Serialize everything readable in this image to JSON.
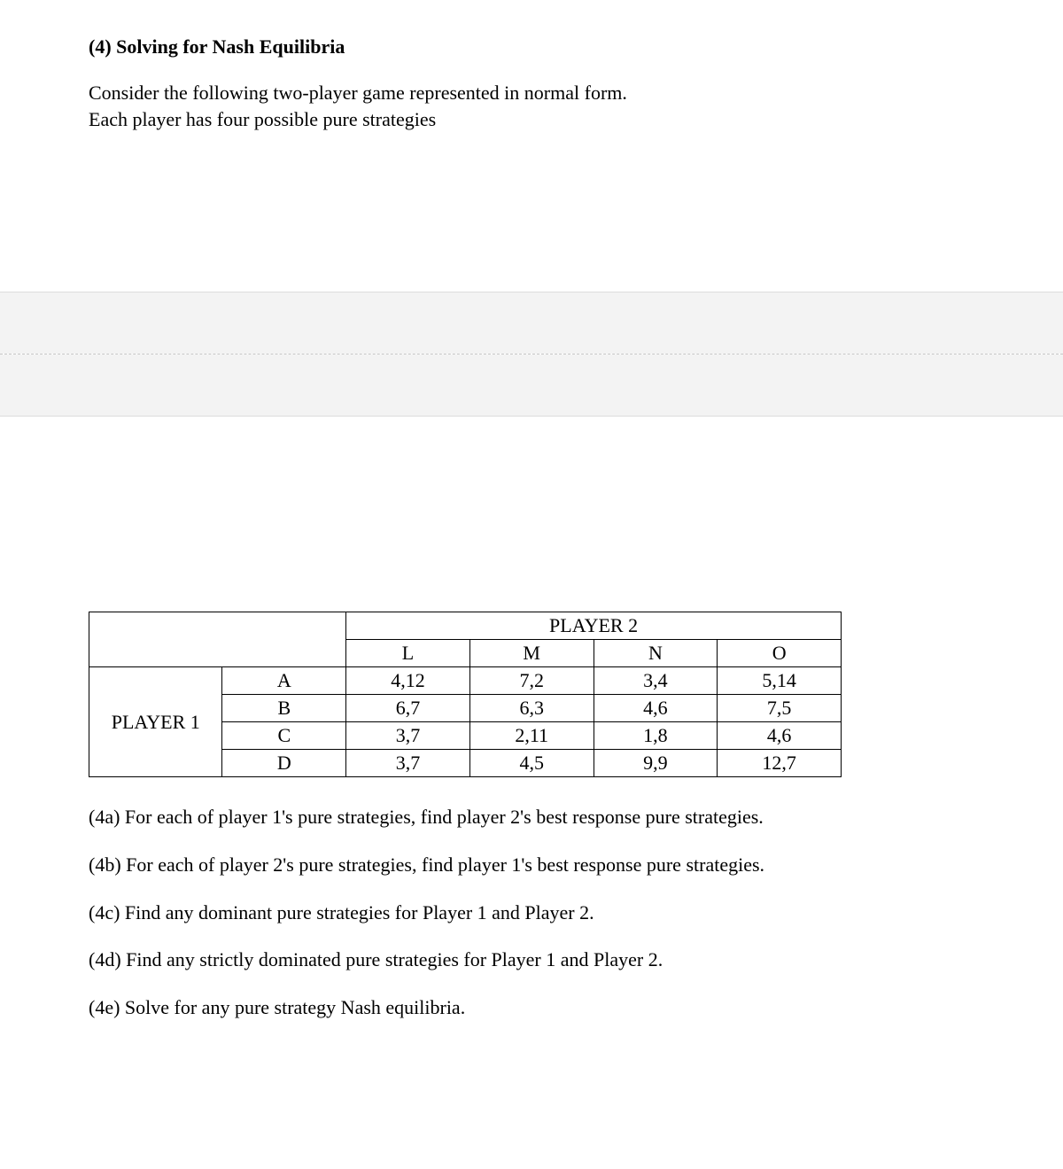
{
  "title": "(4) Solving for Nash Equilibria",
  "intro_line1": "Consider the following two-player game represented in normal form.",
  "intro_line2": "Each player has four possible pure strategies",
  "table": {
    "player2_label": "PLAYER 2",
    "player1_label": "PLAYER 1",
    "col_headers": [
      "L",
      "M",
      "N",
      "O"
    ],
    "row_headers": [
      "A",
      "B",
      "C",
      "D"
    ],
    "cells": [
      [
        "4,12",
        "7,2",
        "3,4",
        "5,14"
      ],
      [
        "6,7",
        "6,3",
        "4,6",
        "7,5"
      ],
      [
        "3,7",
        "2,11",
        "1,8",
        "4,6"
      ],
      [
        "3,7",
        "4,5",
        "9,9",
        "12,7"
      ]
    ]
  },
  "questions": {
    "a": "(4a) For each of player 1's pure strategies, find player 2's best response pure strategies.",
    "b": "(4b) For each of player 2's pure strategies, find player 1's best response pure strategies.",
    "c": "(4c) Find any dominant pure strategies for Player 1 and Player 2.",
    "d": "(4d) Find any strictly dominated pure strategies for Player 1 and Player 2.",
    "e": "(4e) Solve for any pure strategy Nash equilibria."
  }
}
